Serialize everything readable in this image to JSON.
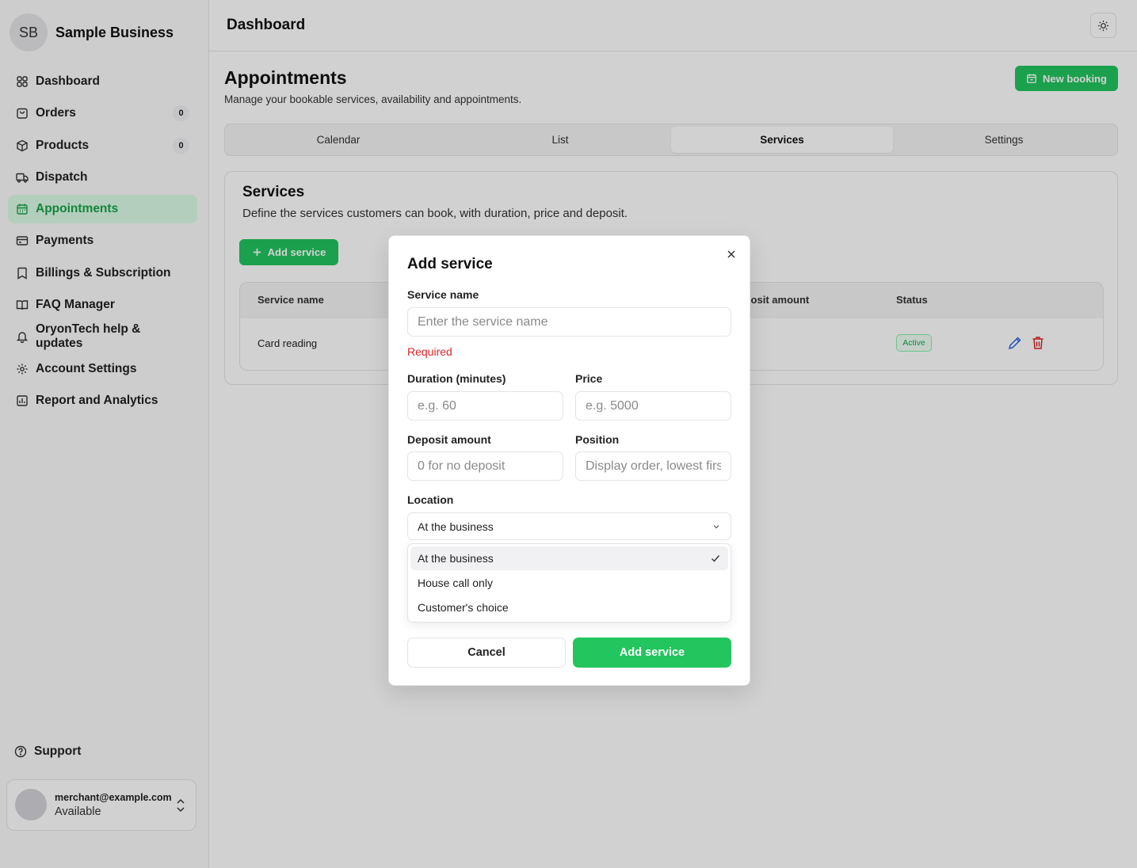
{
  "brand": {
    "initials": "SB",
    "name": "Sample Business"
  },
  "nav": [
    {
      "label": "Dashboard",
      "icon": "dashboard-icon"
    },
    {
      "label": "Orders",
      "icon": "orders-icon",
      "badge": "0"
    },
    {
      "label": "Products",
      "icon": "products-icon",
      "badge": "0"
    },
    {
      "label": "Dispatch",
      "icon": "truck-icon"
    },
    {
      "label": "Appointments",
      "icon": "calendar-icon",
      "active": true
    },
    {
      "label": "Payments",
      "icon": "credit-card-icon"
    },
    {
      "label": "Billings & Subscription",
      "icon": "bookmark-icon"
    },
    {
      "label": "FAQ Manager",
      "icon": "book-icon"
    },
    {
      "label": "OryonTech help & updates",
      "icon": "bell-icon"
    },
    {
      "label": "Account Settings",
      "icon": "gear-icon"
    },
    {
      "label": "Report and Analytics",
      "icon": "chart-icon"
    }
  ],
  "support": {
    "label": "Support"
  },
  "user": {
    "email": "merchant@example.com",
    "status": "Available"
  },
  "header": {
    "title": "Dashboard"
  },
  "page": {
    "title": "Appointments",
    "subtitle": "Manage your bookable services, availability and appointments.",
    "new_booking": "New booking"
  },
  "tabs": [
    "Calendar",
    "List",
    "Services",
    "Settings"
  ],
  "active_tab": "Services",
  "services": {
    "title": "Services",
    "subtitle": "Define the services customers can book, with duration, price and deposit.",
    "add_button": "Add service",
    "columns": {
      "name": "Service name",
      "deposit": "Deposit amount",
      "status": "Status"
    },
    "rows": [
      {
        "name": "Card reading",
        "status": "Active"
      }
    ]
  },
  "modal": {
    "title": "Add service",
    "service_name_label": "Service name",
    "service_name_placeholder": "Enter the service name",
    "service_name_value": "",
    "required": "Required",
    "duration_label": "Duration (minutes)",
    "duration_placeholder": "e.g. 60",
    "price_label": "Price",
    "price_placeholder": "e.g. 5000",
    "deposit_label": "Deposit amount",
    "deposit_placeholder": "0 for no deposit",
    "position_label": "Position",
    "position_placeholder": "Display order, lowest first",
    "location_label": "Location",
    "location_value": "At the business",
    "location_options": [
      "At the business",
      "House call only",
      "Customer's choice"
    ],
    "cancel": "Cancel",
    "submit": "Add service"
  },
  "colors": {
    "accent": "#22c55e",
    "accent_soft": "#dcfce7",
    "error": "#dc2626",
    "danger_icon": "#dc2626",
    "edit_icon": "#2563eb"
  }
}
